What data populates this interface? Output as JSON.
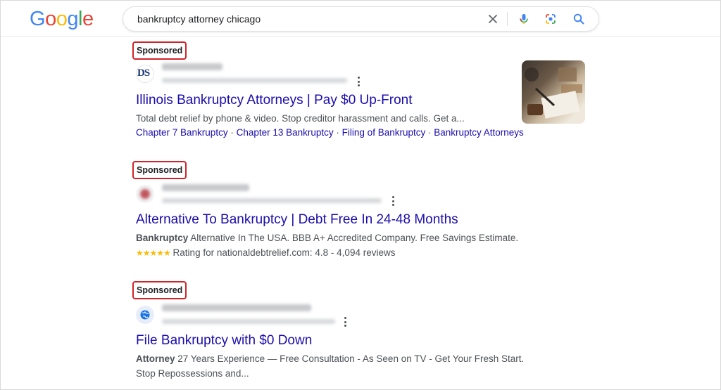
{
  "header": {
    "logo_letters": [
      "G",
      "o",
      "o",
      "g",
      "l",
      "e"
    ],
    "logo_colors": [
      "#4285f4",
      "#ea4335",
      "#fbbc05",
      "#4285f4",
      "#34a853",
      "#ea4335"
    ],
    "search_query": "bankruptcy attorney chicago",
    "icons": [
      "close-icon",
      "microphone-icon",
      "lens-icon",
      "search-icon"
    ]
  },
  "results": [
    {
      "sponsored_label": "Sponsored",
      "favicon_text": "DS",
      "title": "Illinois Bankruptcy Attorneys | Pay $0 Up-Front",
      "description": "Total debt relief by phone & video. Stop creditor harassment and calls. Get a...",
      "sitelinks": [
        "Chapter 7 Bankruptcy",
        "Chapter 13 Bankruptcy",
        "Filing of Bankruptcy",
        "Bankruptcy Attorneys"
      ],
      "sitelink_separator": " · "
    },
    {
      "sponsored_label": "Sponsored",
      "title": "Alternative To Bankruptcy | Debt Free In 24-48 Months",
      "description_bold": "Bankruptcy",
      "description": " Alternative In The USA. BBB A+ Accredited Company. Free Savings Estimate.",
      "rating_stars": "★★★★★",
      "rating_text": " Rating for nationaldebtrelief.com: 4.8 - 4,094 reviews"
    },
    {
      "sponsored_label": "Sponsored",
      "title": "File Bankruptcy with $0 Down",
      "description_bold": "Attorney",
      "description_line1": " 27 Years Experience — Free Consultation - As Seen on TV - Get Your Fresh Start.",
      "description_line2": "Stop Repossessions and..."
    }
  ],
  "colors": {
    "link": "#1a0dab",
    "sponsored_highlight": "#d2232a",
    "star": "#fbbc04"
  }
}
